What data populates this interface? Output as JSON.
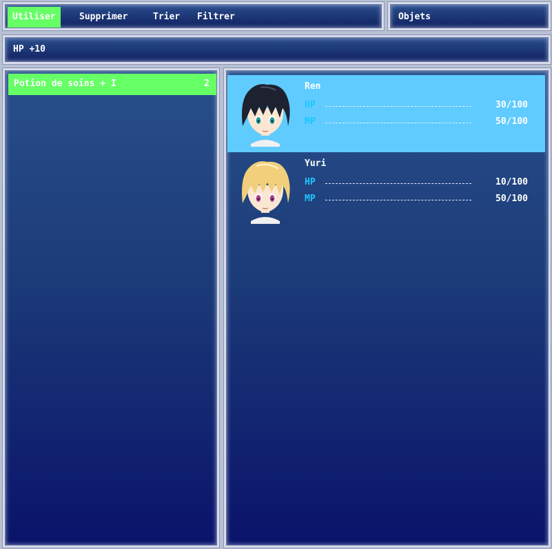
{
  "command_menu": {
    "items": [
      {
        "label": "Utiliser",
        "selected": true
      },
      {
        "label": "Supprimer",
        "selected": false
      },
      {
        "label": "Trier",
        "selected": false
      },
      {
        "label": "Filtrer",
        "selected": false
      }
    ]
  },
  "category_title": "Objets",
  "help_text": "HP +10",
  "item_list": [
    {
      "name": "Potion de soins + I",
      "count": "2"
    }
  ],
  "party": [
    {
      "name": "Ren",
      "hp_label": "HP",
      "hp": "30/100",
      "mp_label": "MP",
      "mp": "50/100",
      "hair_color": "#1e2230",
      "eye_color": "#2a9c9c",
      "selected": true
    },
    {
      "name": "Yuri",
      "hp_label": "HP",
      "hp": "10/100",
      "mp_label": "MP",
      "mp": "50/100",
      "hair_color": "#f2cf7a",
      "eye_color": "#b2488c",
      "selected": false
    }
  ],
  "colors": {
    "selection_green": "#66ff66",
    "selection_blue": "#5fcbff",
    "stat_label": "#1fc6ff",
    "window_bg_top": "#29508a",
    "window_bg_bottom": "#0a136a"
  }
}
